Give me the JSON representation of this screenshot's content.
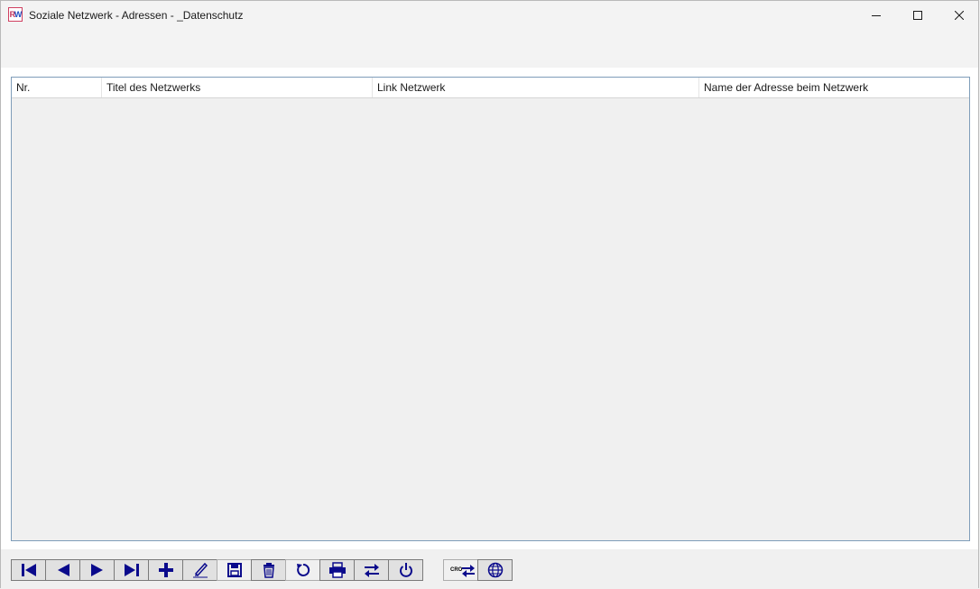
{
  "window": {
    "title": "Soziale Netzwerk - Adressen - _Datenschutz",
    "app_icon_text_r": "R",
    "app_icon_text_w": "W"
  },
  "table": {
    "columns": [
      "Nr.",
      "Titel des Netzwerks",
      "Link Netzwerk",
      "Name der Adresse beim Netzwerk"
    ],
    "rows": []
  },
  "toolbar": {
    "buttons": [
      {
        "name": "first-record",
        "icon": "first-icon"
      },
      {
        "name": "previous-record",
        "icon": "previous-icon"
      },
      {
        "name": "next-record",
        "icon": "next-icon"
      },
      {
        "name": "last-record",
        "icon": "last-icon"
      },
      {
        "name": "add-record",
        "icon": "plus-icon"
      },
      {
        "name": "edit-record",
        "icon": "pencil-icon"
      },
      {
        "name": "save-record",
        "icon": "floppy-icon"
      },
      {
        "name": "delete-record",
        "icon": "trash-icon"
      },
      {
        "name": "refresh",
        "icon": "refresh-icon"
      },
      {
        "name": "print",
        "icon": "printer-icon"
      },
      {
        "name": "transfer",
        "icon": "swap-arrows-icon"
      },
      {
        "name": "power",
        "icon": "power-icon"
      }
    ],
    "extra_buttons": [
      {
        "name": "cro-transfer",
        "icon": "cro-swap-icon",
        "label": "CRO"
      },
      {
        "name": "web",
        "icon": "globe-icon"
      }
    ]
  },
  "colors": {
    "icon_blue": "#0a0a8c",
    "grid_border": "#7f9db9",
    "grid_background": "#f0f0f0"
  }
}
